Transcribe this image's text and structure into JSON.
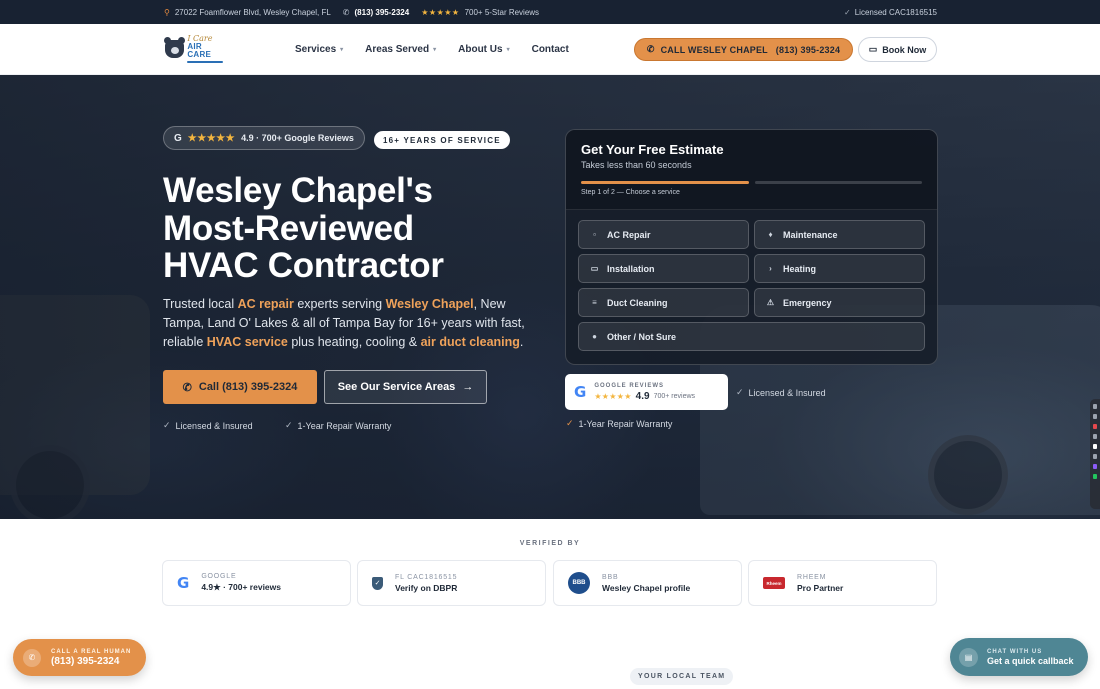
{
  "topbar": {
    "address": "27022 Foamflower Blvd, Wesley Chapel, FL",
    "phone": "(813) 395-2324",
    "stars": "★★★★★",
    "reviews": "700+ 5-Star Reviews",
    "license": "Licensed CAC1816515"
  },
  "logo": {
    "line1": "I Care",
    "line2": "AIR CARE"
  },
  "nav": {
    "items": [
      {
        "label": "Services",
        "dropdown": "▾"
      },
      {
        "label": "Areas Served",
        "dropdown": "▾"
      },
      {
        "label": "About Us",
        "dropdown": "▾"
      },
      {
        "label": "Contact"
      }
    ],
    "call_button": "CALL WESLEY CHAPEL   (813) 395-2324",
    "book_button": "Book Now"
  },
  "hero": {
    "badge_google": "G",
    "badge_stars": "★★★★★",
    "badge_text": "4.9 · 700+ Google Reviews",
    "badge_years": "16+ YEARS OF SERVICE",
    "title_line1": "Wesley Chapel's",
    "title_line2": "Most-Reviewed",
    "title_line3": "HVAC Contractor",
    "desc": {
      "p1": "Trusted local ",
      "h1": "AC repair",
      "p2": " experts serving ",
      "h2": "Wesley Chapel",
      "p3": ", New Tampa, Land O' Lakes & all of Tampa Bay for 16+ years with fast, reliable ",
      "h3": "HVAC service",
      "p4": " plus heating, cooling & ",
      "h4": "air duct cleaning",
      "p5": "."
    },
    "call_button": "Call (813) 395-2324",
    "areas_button": "See Our Service Areas",
    "trust1": "Licensed & Insured",
    "trust2": "1-Year Repair Warranty"
  },
  "estimate": {
    "title": "Get Your Free Estimate",
    "subtitle": "Takes less than 60 seconds",
    "step": "Step 1 of 2 — Choose a service",
    "progress_fraction": 0.5,
    "services": [
      {
        "label": "AC Repair",
        "icon": "snowflake-icon"
      },
      {
        "label": "Maintenance",
        "icon": "wrench-icon"
      },
      {
        "label": "Installation",
        "icon": "unit-icon"
      },
      {
        "label": "Heating",
        "icon": "flame-icon"
      },
      {
        "label": "Duct Cleaning",
        "icon": "vent-icon"
      },
      {
        "label": "Emergency",
        "icon": "warning-icon"
      },
      {
        "label": "Other / Not Sure",
        "icon": "dot-icon"
      }
    ]
  },
  "google_card": {
    "label": "GOOGLE REVIEWS",
    "stars": "★★★★★",
    "score": "4.9",
    "count": "700+ reviews"
  },
  "hero_trust_right": {
    "licensed": "Licensed & Insured",
    "warranty": "1-Year Repair Warranty"
  },
  "verified": {
    "label": "VERIFIED BY",
    "cards": [
      {
        "small": "GOOGLE",
        "big": "4.9★ · 700+ reviews"
      },
      {
        "small": "FL CAC1816515",
        "big": "Verify on DBPR"
      },
      {
        "small": "BBB",
        "big": "Wesley Chapel profile"
      },
      {
        "small": "RHEEM",
        "big": "Pro Partner"
      }
    ]
  },
  "local_team": "YOUR LOCAL TEAM",
  "float_call": {
    "small": "CALL A REAL HUMAN",
    "big": "(813) 395-2324"
  },
  "float_chat": {
    "small": "CHAT WITH US",
    "big": "Get a quick callback"
  },
  "colors": {
    "accent": "#e3914a",
    "topbar": "#182232",
    "chat": "#4f8694",
    "star": "#f3b53f"
  }
}
